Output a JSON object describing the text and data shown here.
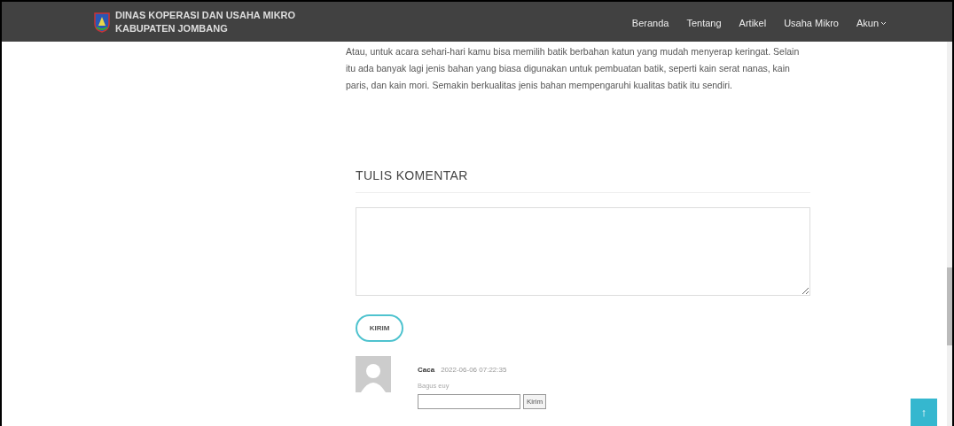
{
  "header": {
    "logo_line_1": "DINAS KOPERASI DAN USAHA MIKRO",
    "logo_line_2": "KABUPATEN JOMBANG",
    "nav": [
      {
        "label": "Beranda",
        "kind": "link"
      },
      {
        "label": "Tentang",
        "kind": "link"
      },
      {
        "label": "Artikel",
        "kind": "link"
      },
      {
        "label": "Usaha Mikro",
        "kind": "link"
      },
      {
        "label": "Akun",
        "kind": "dropdown"
      }
    ]
  },
  "article": {
    "paragraph": "Atau, untuk acara sehari-hari kamu bisa memilih batik berbahan katun yang mudah menyerap keringat. Selain itu ada banyak lagi jenis bahan yang biasa digunakan untuk pembuatan batik, seperti kain serat nanas, kain paris, dan kain mori. Semakin berkualitas jenis bahan mempengaruhi kualitas batik itu sendiri."
  },
  "comment_form": {
    "heading": "TULIS KOMENTAR",
    "submit": "KIRIM"
  },
  "comments": [
    {
      "author": "Caca",
      "time": "2022-06-06 07:22:35",
      "text": "Bagus euy",
      "reply_button": "Kirim"
    }
  ],
  "back_to_top": "↑"
}
